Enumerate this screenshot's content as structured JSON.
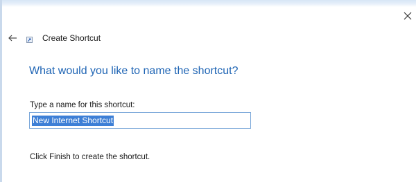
{
  "window": {
    "title": "Create Shortcut",
    "close_icon": "close-icon",
    "back_icon": "back-arrow-icon",
    "app_icon": "shortcut-wizard-icon"
  },
  "main": {
    "heading": "What would you like to name the shortcut?",
    "name_field": {
      "label": "Type a name for this shortcut:",
      "value": "New Internet Shortcut",
      "selected": true
    },
    "instruction": "Click Finish to create the shortcut."
  },
  "colors": {
    "heading": "#1e64b4",
    "selection": "#3d7fd6",
    "input_border": "#7aa7d9"
  }
}
